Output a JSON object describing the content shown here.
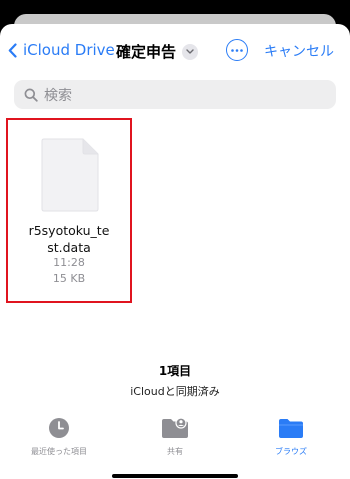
{
  "nav": {
    "back_label": "iCloud Drive",
    "title": "確定申告",
    "cancel_label": "キャンセル"
  },
  "search": {
    "placeholder": "検索"
  },
  "files": [
    {
      "name": "r5syotoku_test.data",
      "time": "11:28",
      "size": "15 KB",
      "selected": true
    }
  ],
  "footer": {
    "item_count": "1項目",
    "sync_status": "iCloudと同期済み"
  },
  "tabs": [
    {
      "label": "最近使った項目",
      "icon": "clock-icon",
      "active": false
    },
    {
      "label": "共有",
      "icon": "shared-folder-icon",
      "active": false
    },
    {
      "label": "ブラウズ",
      "icon": "folder-icon",
      "active": true
    }
  ],
  "colors": {
    "accent": "#2a7cf6",
    "highlight": "#e0141f"
  }
}
